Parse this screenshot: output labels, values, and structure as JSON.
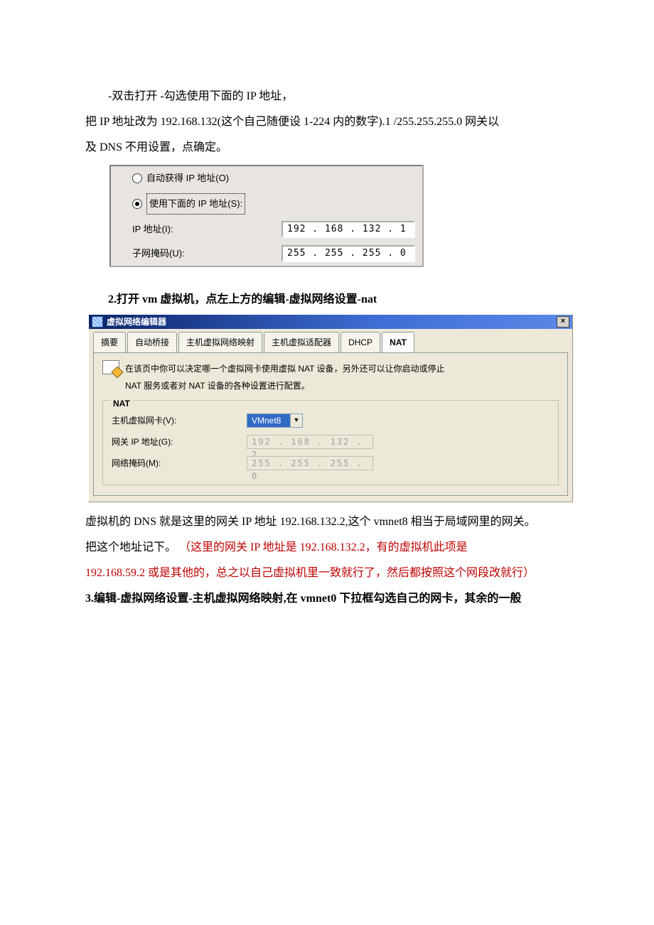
{
  "doc": {
    "line1": "-双击打开 -勾选使用下面的 IP 地址，",
    "line2a": "把 IP 地址改为 192.168.132(这个自己随便设 1-224 内的数字).1 /255.255.255.0 网关以",
    "line2b": "及 DNS 不用设置，点确定。",
    "step2_title": "2.打开 vm 虚拟机，点左上方的编辑-虚拟网络设置-nat",
    "after2a": "虚拟机的 DNS 就是这里的网关 IP 地址 192.168.132.2,这个 vmnet8 相当于局域网里的网关。",
    "after2b_plain": "把这个地址记下。",
    "after2b_red1": "（这里的网关 IP 地址是 192.168.132.2，有的虚拟机此项是",
    "after2c_red": "192.168.59.2 或是其他的，总之以自己虚拟机里一致就行了，然后都按照这个网段改就行）",
    "step3": "3.编辑-虚拟网络设置-主机虚拟网络映射,在 vmnet0 下拉框勾选自己的网卡，其余的一般"
  },
  "tcpip": {
    "radio_auto": "自动获得 IP 地址(O)",
    "radio_manual": "使用下面的 IP 地址(S):",
    "ip_label": "IP 地址(I):",
    "ip_value": "192 . 168 . 132 .  1",
    "mask_label": "子网掩码(U):",
    "mask_value": "255 . 255 . 255 .  0"
  },
  "vm": {
    "window_title": "虚拟网络编辑器",
    "close": "×",
    "tabs": {
      "summary": "摘要",
      "autobridge": "自动桥接",
      "hostmap": "主机虚拟网络映射",
      "hostadapter": "主机虚拟适配器",
      "dhcp": "DHCP",
      "nat": "NAT"
    },
    "desc_line1": "在该页中你可以决定哪一个虚拟网卡使用虚拟 NAT 设备，另外还可以让你启动或停止",
    "desc_line2": "NAT 服务或者对 NAT 设备的各种设置进行配置。",
    "group_legend": "NAT",
    "vnic_label": "主机虚拟网卡(V):",
    "vnic_value": "VMnet8",
    "gw_label": "网关 IP 地址(G):",
    "gw_value": "192 . 168 . 132 .  2",
    "mask_label": "网络掩码(M):",
    "mask_value": "255 . 255 . 255 .  0"
  }
}
